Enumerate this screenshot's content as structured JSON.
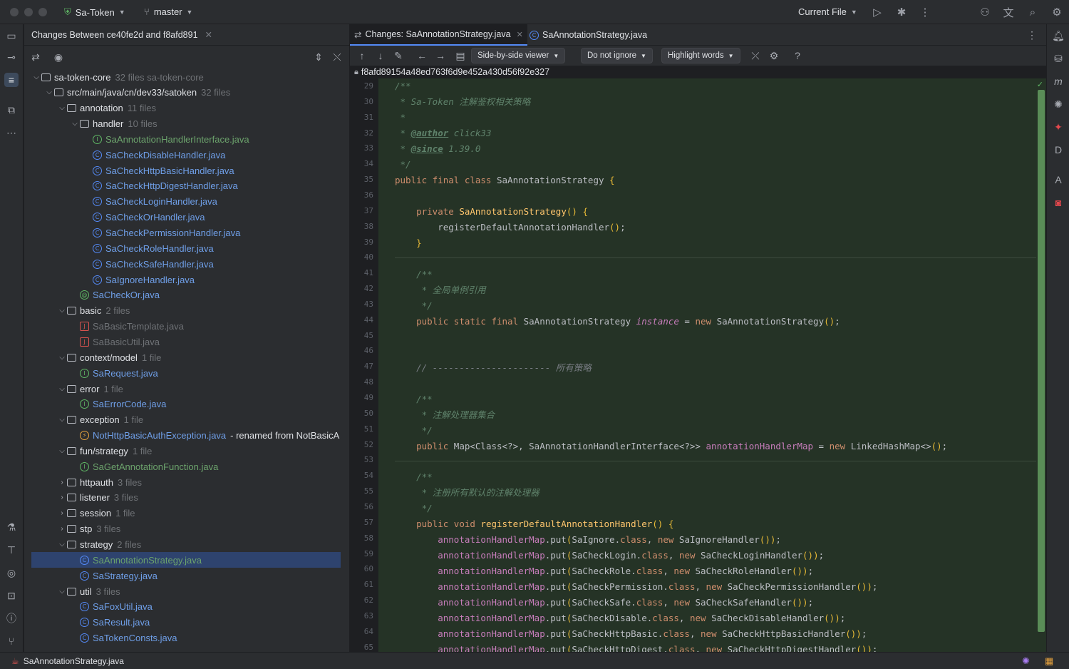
{
  "titlebar": {
    "project": "Sa-Token",
    "branch": "master",
    "run_config": "Current File"
  },
  "left_panel": {
    "tab_title": "Changes Between ce40fe2d and f8afd891",
    "tree": [
      {
        "depth": 0,
        "type": "module",
        "name": "sa-token-core",
        "count": "32 files sa-token-core",
        "expanded": true
      },
      {
        "depth": 1,
        "type": "folder",
        "name": "src/main/java/cn/dev33/satoken",
        "count": "32 files",
        "expanded": true
      },
      {
        "depth": 2,
        "type": "folder",
        "name": "annotation",
        "count": "11 files",
        "expanded": true
      },
      {
        "depth": 3,
        "type": "folder",
        "name": "handler",
        "count": "10 files",
        "expanded": true
      },
      {
        "depth": 4,
        "type": "interface",
        "name": "SaAnnotationHandlerInterface.java",
        "color": "grn"
      },
      {
        "depth": 4,
        "type": "class",
        "name": "SaCheckDisableHandler.java",
        "color": "mod"
      },
      {
        "depth": 4,
        "type": "class",
        "name": "SaCheckHttpBasicHandler.java",
        "color": "mod"
      },
      {
        "depth": 4,
        "type": "class",
        "name": "SaCheckHttpDigestHandler.java",
        "color": "mod"
      },
      {
        "depth": 4,
        "type": "class",
        "name": "SaCheckLoginHandler.java",
        "color": "mod"
      },
      {
        "depth": 4,
        "type": "class",
        "name": "SaCheckOrHandler.java",
        "color": "mod"
      },
      {
        "depth": 4,
        "type": "class",
        "name": "SaCheckPermissionHandler.java",
        "color": "mod"
      },
      {
        "depth": 4,
        "type": "class",
        "name": "SaCheckRoleHandler.java",
        "color": "mod"
      },
      {
        "depth": 4,
        "type": "class",
        "name": "SaCheckSafeHandler.java",
        "color": "mod"
      },
      {
        "depth": 4,
        "type": "class",
        "name": "SaIgnoreHandler.java",
        "color": "mod"
      },
      {
        "depth": 3,
        "type": "annotation",
        "name": "SaCheckOr.java",
        "color": "mod"
      },
      {
        "depth": 2,
        "type": "folder",
        "name": "basic",
        "count": "2 files",
        "expanded": true
      },
      {
        "depth": 3,
        "type": "java",
        "name": "SaBasicTemplate.java",
        "color": "dim"
      },
      {
        "depth": 3,
        "type": "java",
        "name": "SaBasicUtil.java",
        "color": "dim"
      },
      {
        "depth": 2,
        "type": "folder",
        "name": "context/model",
        "count": "1 file",
        "expanded": true
      },
      {
        "depth": 3,
        "type": "interface",
        "name": "SaRequest.java",
        "color": "mod"
      },
      {
        "depth": 2,
        "type": "folder",
        "name": "error",
        "count": "1 file",
        "expanded": true
      },
      {
        "depth": 3,
        "type": "interface",
        "name": "SaErrorCode.java",
        "color": "mod"
      },
      {
        "depth": 2,
        "type": "folder",
        "name": "exception",
        "count": "1 file",
        "expanded": true
      },
      {
        "depth": 3,
        "type": "exception",
        "name": "NotHttpBasicAuthException.java",
        "color": "mod",
        "suffix": "- renamed from NotBasicA"
      },
      {
        "depth": 2,
        "type": "folder",
        "name": "fun/strategy",
        "count": "1 file",
        "expanded": true
      },
      {
        "depth": 3,
        "type": "interface",
        "name": "SaGetAnnotationFunction.java",
        "color": "grn"
      },
      {
        "depth": 2,
        "type": "folder",
        "name": "httpauth",
        "count": "3 files",
        "expanded": false
      },
      {
        "depth": 2,
        "type": "folder",
        "name": "listener",
        "count": "3 files",
        "expanded": false
      },
      {
        "depth": 2,
        "type": "folder",
        "name": "session",
        "count": "1 file",
        "expanded": false
      },
      {
        "depth": 2,
        "type": "folder",
        "name": "stp",
        "count": "3 files",
        "expanded": false
      },
      {
        "depth": 2,
        "type": "folder",
        "name": "strategy",
        "count": "2 files",
        "expanded": true
      },
      {
        "depth": 3,
        "type": "class",
        "name": "SaAnnotationStrategy.java",
        "color": "grn",
        "selected": true
      },
      {
        "depth": 3,
        "type": "class",
        "name": "SaStrategy.java",
        "color": "mod"
      },
      {
        "depth": 2,
        "type": "folder",
        "name": "util",
        "count": "3 files",
        "expanded": true
      },
      {
        "depth": 3,
        "type": "class",
        "name": "SaFoxUtil.java",
        "color": "mod"
      },
      {
        "depth": 3,
        "type": "class",
        "name": "SaResult.java",
        "color": "mod"
      },
      {
        "depth": 3,
        "type": "class",
        "name": "SaTokenConsts.java",
        "color": "mod"
      }
    ]
  },
  "editor": {
    "tabs": [
      {
        "label": "Changes: SaAnnotationStrategy.java",
        "active": true
      },
      {
        "label": "SaAnnotationStrategy.java",
        "active": false
      }
    ],
    "viewer_mode": "Side-by-side viewer",
    "ignore_mode": "Do not ignore",
    "highlight_mode": "Highlight words",
    "revision_hash": "f8afd89154a48ed763f6d9e452a430d56f92e327",
    "line_numbers": [
      "29",
      "30",
      "31",
      "32",
      "33",
      "34",
      "35",
      "36",
      "37",
      "38",
      "39",
      "40",
      "41",
      "42",
      "43",
      "44",
      "45",
      "46",
      "47",
      "48",
      "49",
      "50",
      "51",
      "52",
      "53",
      "54",
      "55",
      "56",
      "57",
      "58",
      "59",
      "60",
      "61",
      "62",
      "63",
      "64",
      "65"
    ]
  },
  "statusbar": {
    "file": "SaAnnotationStrategy.java"
  }
}
